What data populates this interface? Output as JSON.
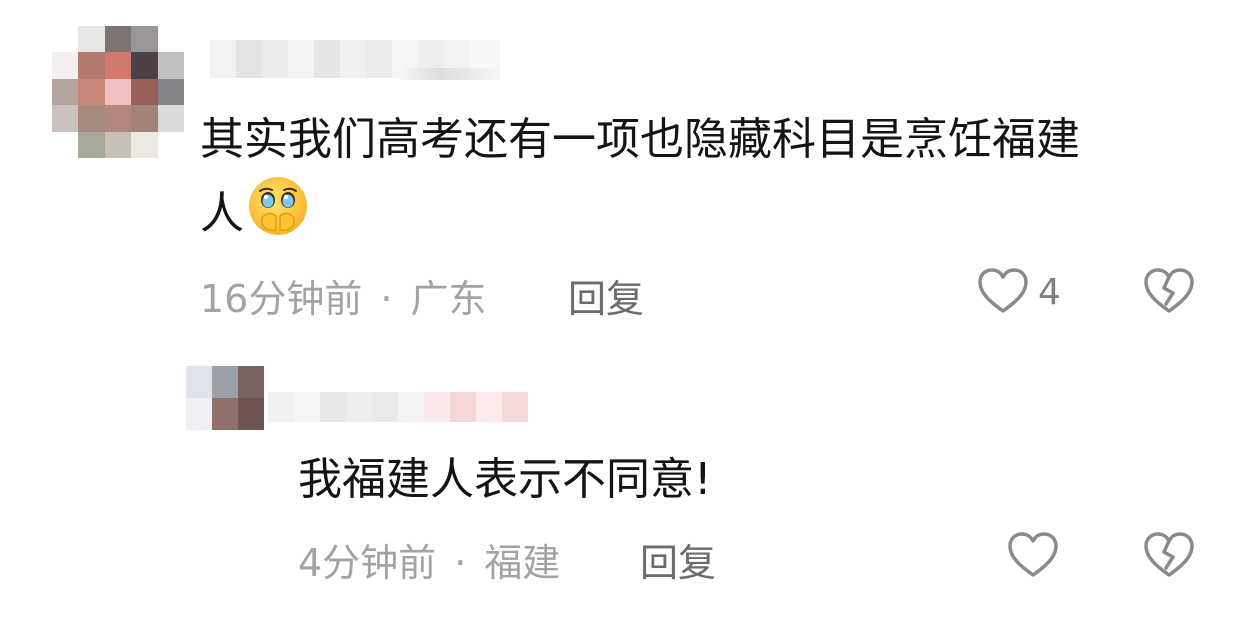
{
  "comments": [
    {
      "text_line1": "其实我们高考还有一项也隐藏科目是烹饪福建",
      "text_line2": "人",
      "emoji": "face-holding-back-tears-icon",
      "time": "16分钟前",
      "location": "广东",
      "reply_label": "回复",
      "like_count": "4"
    },
    {
      "text": "我福建人表示不同意!",
      "time": "4分钟前",
      "location": "福建",
      "reply_label": "回复"
    }
  ],
  "separator": "·",
  "colors": {
    "text": "#141414",
    "meta": "#a3a3a3",
    "reply": "#6b6b6b",
    "icon": "#8a8a8a"
  },
  "icons": [
    "heart-outline-icon",
    "broken-heart-icon"
  ]
}
